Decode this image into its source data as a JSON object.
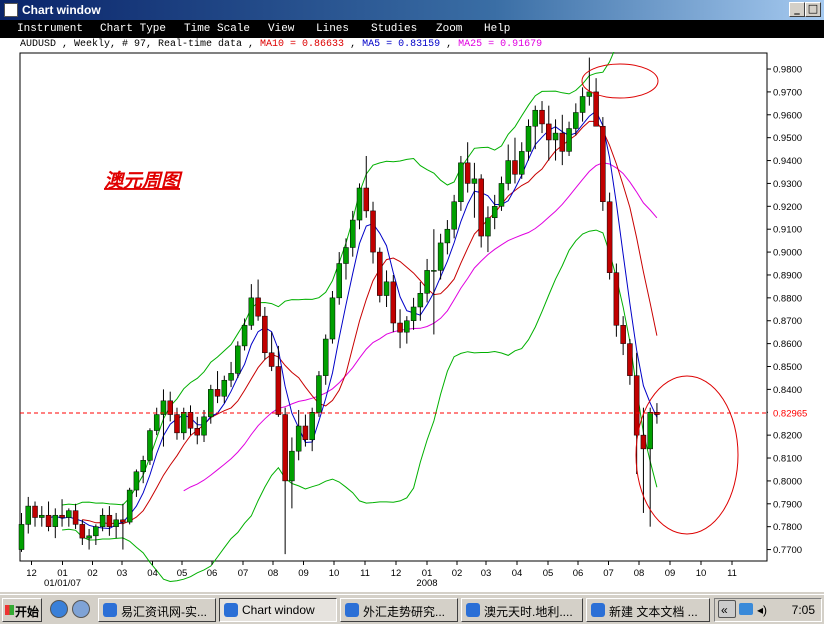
{
  "window": {
    "title": "Chart window"
  },
  "menu": [
    "Instrument",
    "Chart Type",
    "Time Scale",
    "View",
    "Lines",
    "Studies",
    "Zoom",
    "Help"
  ],
  "info": {
    "instrument": "AUDUSD , Weekly, # 97, Real-time data , ",
    "ma10": "MA10 = 0.86633",
    "ma5": "MA5 = 0.83159",
    "ma25": "MA25 = 0.91679",
    "sep": " , "
  },
  "taskbar": {
    "start": "开始",
    "tasks": [
      "易汇资讯网-实...",
      "Chart window",
      "外汇走势研究...",
      "澳元天时.地利....",
      "新建 文本文档 ..."
    ],
    "clock": "7:05"
  },
  "chart_data": {
    "type": "candlestick",
    "instrument": "AUDUSD",
    "timeframe": "Weekly",
    "annotation": "澳元周图",
    "ylim": [
      0.765,
      0.987
    ],
    "y_ticks": [
      0.77,
      0.78,
      0.79,
      0.8,
      0.81,
      0.82,
      0.83,
      0.84,
      0.85,
      0.86,
      0.87,
      0.88,
      0.89,
      0.9,
      0.91,
      0.92,
      0.93,
      0.94,
      0.95,
      0.96,
      0.97,
      0.98
    ],
    "y_tick_labels": [
      "0.7700",
      "0.7800",
      "0.7900",
      "0.8000",
      "0.8100",
      "0.8200",
      "0.8300",
      "0.8400",
      "0.8500",
      "0.8600",
      "0.8700",
      "0.8800",
      "0.8900",
      "0.9000",
      "0.9100",
      "0.9200",
      "0.9300",
      "0.9400",
      "0.9500",
      "0.9600",
      "0.9700",
      "0.9800"
    ],
    "x_tick_labels": [
      "12",
      "01",
      "02",
      "03",
      "04",
      "05",
      "06",
      "07",
      "08",
      "09",
      "10",
      "11",
      "12",
      "01",
      "02",
      "03",
      "04",
      "05",
      "06",
      "07",
      "08",
      "09",
      "10",
      "11"
    ],
    "x_sub_labels": [
      {
        "label": "01/01/07",
        "at_tick": 1
      },
      {
        "label": "2008",
        "at_tick": 13
      }
    ],
    "current_price": {
      "value": 0.82965,
      "label": "0.82965",
      "color": "#ff0000"
    },
    "up_color": "#00a000",
    "down_color": "#c00000",
    "candles": [
      [
        0.77,
        0.786,
        0.769,
        0.781
      ],
      [
        0.781,
        0.793,
        0.777,
        0.789
      ],
      [
        0.789,
        0.791,
        0.78,
        0.784
      ],
      [
        0.784,
        0.789,
        0.78,
        0.785
      ],
      [
        0.785,
        0.791,
        0.778,
        0.78
      ],
      [
        0.78,
        0.788,
        0.775,
        0.785
      ],
      [
        0.785,
        0.792,
        0.78,
        0.784
      ],
      [
        0.784,
        0.788,
        0.78,
        0.787
      ],
      [
        0.787,
        0.79,
        0.779,
        0.781
      ],
      [
        0.781,
        0.783,
        0.772,
        0.775
      ],
      [
        0.775,
        0.779,
        0.77,
        0.776
      ],
      [
        0.776,
        0.781,
        0.772,
        0.78
      ],
      [
        0.78,
        0.788,
        0.778,
        0.785
      ],
      [
        0.785,
        0.789,
        0.776,
        0.78
      ],
      [
        0.78,
        0.786,
        0.775,
        0.783
      ],
      [
        0.783,
        0.79,
        0.77,
        0.782
      ],
      [
        0.782,
        0.797,
        0.781,
        0.796
      ],
      [
        0.796,
        0.805,
        0.793,
        0.804
      ],
      [
        0.804,
        0.811,
        0.799,
        0.809
      ],
      [
        0.809,
        0.823,
        0.807,
        0.822
      ],
      [
        0.822,
        0.832,
        0.82,
        0.829
      ],
      [
        0.829,
        0.84,
        0.815,
        0.835
      ],
      [
        0.835,
        0.839,
        0.826,
        0.829
      ],
      [
        0.829,
        0.832,
        0.818,
        0.821
      ],
      [
        0.821,
        0.832,
        0.818,
        0.83
      ],
      [
        0.83,
        0.833,
        0.82,
        0.823
      ],
      [
        0.823,
        0.828,
        0.816,
        0.82
      ],
      [
        0.82,
        0.831,
        0.817,
        0.828
      ],
      [
        0.828,
        0.842,
        0.825,
        0.84
      ],
      [
        0.84,
        0.848,
        0.834,
        0.837
      ],
      [
        0.837,
        0.846,
        0.834,
        0.844
      ],
      [
        0.844,
        0.852,
        0.841,
        0.847
      ],
      [
        0.847,
        0.861,
        0.845,
        0.859
      ],
      [
        0.859,
        0.871,
        0.857,
        0.868
      ],
      [
        0.868,
        0.886,
        0.866,
        0.88
      ],
      [
        0.88,
        0.888,
        0.87,
        0.872
      ],
      [
        0.872,
        0.876,
        0.853,
        0.856
      ],
      [
        0.856,
        0.865,
        0.848,
        0.85
      ],
      [
        0.85,
        0.859,
        0.828,
        0.829
      ],
      [
        0.829,
        0.832,
        0.768,
        0.8
      ],
      [
        0.8,
        0.819,
        0.788,
        0.813
      ],
      [
        0.813,
        0.831,
        0.809,
        0.824
      ],
      [
        0.824,
        0.829,
        0.815,
        0.818
      ],
      [
        0.818,
        0.832,
        0.813,
        0.83
      ],
      [
        0.83,
        0.848,
        0.828,
        0.846
      ],
      [
        0.846,
        0.864,
        0.842,
        0.862
      ],
      [
        0.862,
        0.883,
        0.86,
        0.88
      ],
      [
        0.88,
        0.9,
        0.877,
        0.895
      ],
      [
        0.895,
        0.906,
        0.888,
        0.902
      ],
      [
        0.902,
        0.918,
        0.898,
        0.914
      ],
      [
        0.914,
        0.93,
        0.91,
        0.928
      ],
      [
        0.928,
        0.942,
        0.915,
        0.918
      ],
      [
        0.918,
        0.922,
        0.895,
        0.9
      ],
      [
        0.9,
        0.902,
        0.878,
        0.881
      ],
      [
        0.881,
        0.892,
        0.876,
        0.887
      ],
      [
        0.887,
        0.89,
        0.865,
        0.869
      ],
      [
        0.869,
        0.875,
        0.858,
        0.865
      ],
      [
        0.865,
        0.872,
        0.86,
        0.87
      ],
      [
        0.87,
        0.88,
        0.866,
        0.876
      ],
      [
        0.876,
        0.887,
        0.87,
        0.882
      ],
      [
        0.882,
        0.897,
        0.878,
        0.892
      ],
      [
        0.892,
        0.91,
        0.864,
        0.892
      ],
      [
        0.892,
        0.908,
        0.888,
        0.904
      ],
      [
        0.904,
        0.914,
        0.899,
        0.91
      ],
      [
        0.91,
        0.925,
        0.906,
        0.922
      ],
      [
        0.922,
        0.942,
        0.918,
        0.939
      ],
      [
        0.939,
        0.948,
        0.926,
        0.93
      ],
      [
        0.93,
        0.939,
        0.915,
        0.932
      ],
      [
        0.932,
        0.934,
        0.902,
        0.907
      ],
      [
        0.907,
        0.92,
        0.9,
        0.915
      ],
      [
        0.915,
        0.925,
        0.91,
        0.92
      ],
      [
        0.92,
        0.933,
        0.918,
        0.93
      ],
      [
        0.93,
        0.947,
        0.927,
        0.94
      ],
      [
        0.94,
        0.95,
        0.93,
        0.934
      ],
      [
        0.934,
        0.948,
        0.932,
        0.944
      ],
      [
        0.944,
        0.958,
        0.94,
        0.955
      ],
      [
        0.955,
        0.964,
        0.945,
        0.962
      ],
      [
        0.962,
        0.966,
        0.952,
        0.956
      ],
      [
        0.956,
        0.964,
        0.94,
        0.949
      ],
      [
        0.949,
        0.958,
        0.94,
        0.952
      ],
      [
        0.952,
        0.96,
        0.938,
        0.944
      ],
      [
        0.944,
        0.957,
        0.942,
        0.954
      ],
      [
        0.954,
        0.965,
        0.951,
        0.961
      ],
      [
        0.961,
        0.972,
        0.957,
        0.968
      ],
      [
        0.968,
        0.985,
        0.964,
        0.97
      ],
      [
        0.97,
        0.976,
        0.956,
        0.955
      ],
      [
        0.955,
        0.959,
        0.918,
        0.922
      ],
      [
        0.922,
        0.926,
        0.888,
        0.891
      ],
      [
        0.891,
        0.895,
        0.863,
        0.868
      ],
      [
        0.868,
        0.872,
        0.855,
        0.86
      ],
      [
        0.86,
        0.862,
        0.842,
        0.846
      ],
      [
        0.846,
        0.856,
        0.803,
        0.82
      ],
      [
        0.82,
        0.832,
        0.786,
        0.814
      ],
      [
        0.814,
        0.832,
        0.78,
        0.83
      ],
      [
        0.83,
        0.834,
        0.825,
        0.829
      ]
    ],
    "series": [
      {
        "name": "MA5",
        "color": "#0000c8"
      },
      {
        "name": "MA10",
        "color": "#c80000"
      },
      {
        "name": "MA25",
        "color": "#e000e0"
      },
      {
        "name": "Bollinger",
        "color": "#00b000"
      }
    ]
  }
}
